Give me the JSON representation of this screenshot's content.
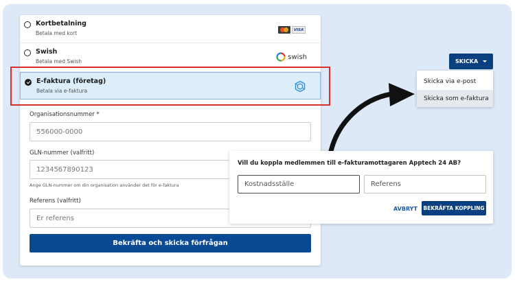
{
  "payment_options": [
    {
      "name": "Kortbetalning",
      "sub": "Betala med kort"
    },
    {
      "name": "Swish",
      "sub": "Betala med Swish"
    },
    {
      "name": "E-faktura (företag)",
      "sub": "Betala via e-faktura"
    }
  ],
  "logos": {
    "visa": "VISA",
    "swish": "swish"
  },
  "form": {
    "org_label": "Organisationsnummer *",
    "org_placeholder": "556000-0000",
    "gln_label": "GLN-nummer (valfritt)",
    "gln_placeholder": "1234567890123",
    "gln_hint": "Ange GLN-nummer om din organisation använder det för e-faktura",
    "ref_label": "Referens (valfritt)",
    "ref_placeholder": "Er referens",
    "submit_label": "Bekräfta och skicka förfrågan"
  },
  "send_button": {
    "label": "SKICKA",
    "icon": "caret-down-icon"
  },
  "send_menu": [
    "Skicka via e-post",
    "Skicka som e-faktura"
  ],
  "dialog": {
    "question": "Vill du koppla medlemmen till e-fakturamottagaren Apptech 24 AB?",
    "field1_placeholder": "Kostnadsställe",
    "field2_placeholder": "Referens",
    "cancel_label": "AVBRYT",
    "confirm_label": "BEKRÄFTA KOPPLING"
  },
  "colors": {
    "primary": "#0a4a94",
    "highlight": "#d62d2d",
    "selected_bg": "#dcedfb",
    "background": "#dde9f7"
  }
}
